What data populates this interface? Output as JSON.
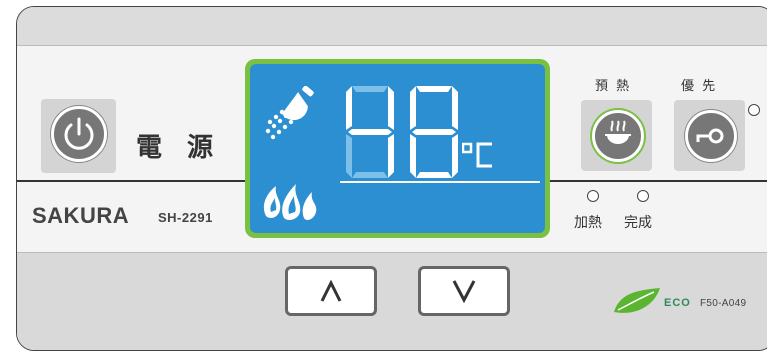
{
  "power": {
    "label": "電 源"
  },
  "brand": {
    "name": "SAKURA",
    "model": "SH-2291"
  },
  "display": {
    "temperature": "48",
    "unit": "oC",
    "icons": [
      "shower-icon",
      "flame-icon"
    ],
    "colors": {
      "frame": "#7ac043",
      "screen": "#2b8fd1",
      "segment": "#ffffff"
    }
  },
  "preheat": {
    "label": "預 熱",
    "icon": "bowl-steam-icon"
  },
  "priority": {
    "label": "優 先",
    "icon": "key-icon"
  },
  "indicators": {
    "heating_label": "加熱",
    "done_label": "完成"
  },
  "controls": {
    "up_icon": "chevron-up-icon",
    "down_icon": "chevron-down-icon"
  },
  "eco": {
    "label": "ECO",
    "model": "F50-A049",
    "icon": "leaf-icon",
    "color": "#5cb531"
  }
}
